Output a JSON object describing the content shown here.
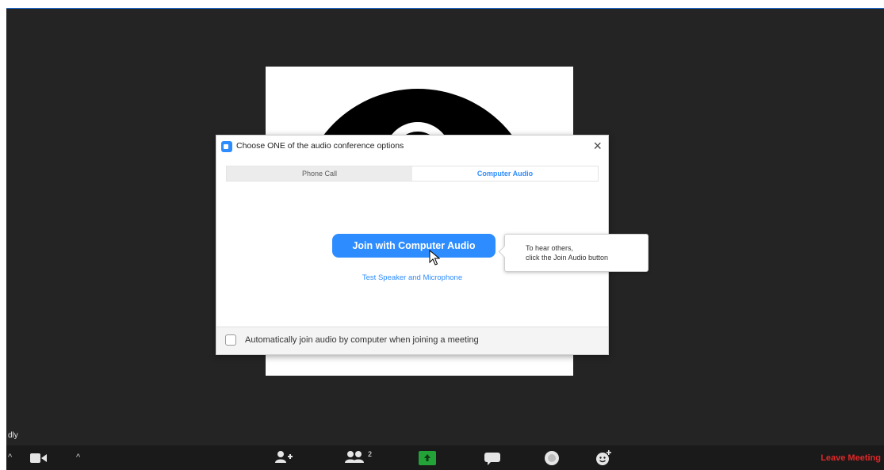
{
  "dialog": {
    "title": "Choose ONE of the audio conference options",
    "tabs": [
      {
        "label": "Phone Call",
        "selected": false
      },
      {
        "label": "Computer Audio",
        "selected": true
      }
    ],
    "join_button_label": "Join with Computer Audio",
    "test_link_label": "Test Speaker and Microphone",
    "auto_join_label": "Automatically join audio by computer when joining a meeting",
    "auto_join_checked": false
  },
  "tooltip": {
    "line1": "To hear others,",
    "line2": "click the Join Audio button"
  },
  "participant_name_fragment": "dly",
  "toolbar": {
    "participants_count": "2",
    "leave_label": "Leave Meeting",
    "icons": [
      "caret-up-icon",
      "video-camera-icon",
      "caret-up-icon",
      "invite-icon",
      "participants-icon",
      "share-screen-icon",
      "chat-icon",
      "record-icon",
      "reactions-icon"
    ]
  },
  "colors": {
    "accent": "#2d8cff",
    "window_background": "#242424",
    "leave": "#e02828",
    "share_green": "#23a238"
  }
}
